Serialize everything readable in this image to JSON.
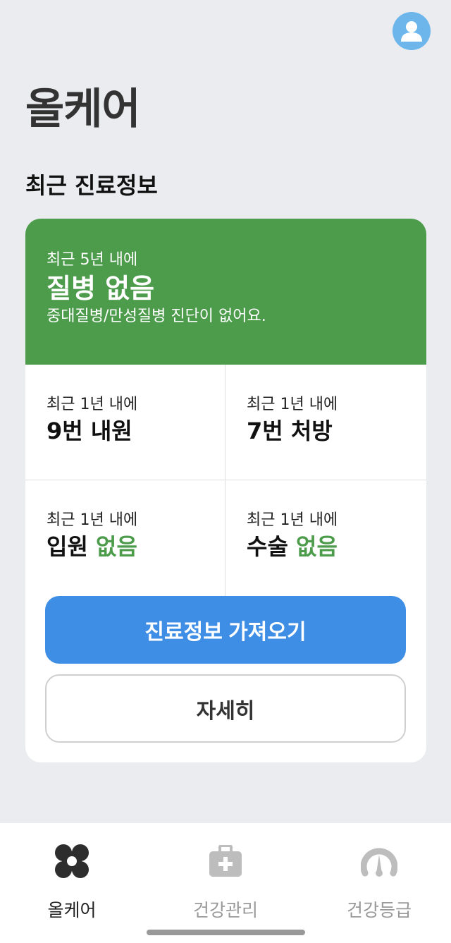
{
  "header": {
    "app_title": "올케어",
    "avatar_icon": "user-avatar-icon"
  },
  "section": {
    "title": "최근 진료정보"
  },
  "hero": {
    "subtitle": "최근 5년 내에",
    "main": "질병 없음",
    "description": "중대질병/만성질병 진단이 없어요.",
    "color": "#4c9c4c"
  },
  "stats": [
    {
      "subtitle": "최근 1년 내에",
      "label": "9번 내원",
      "accent": ""
    },
    {
      "subtitle": "최근 1년 내에",
      "label": "7번 처방",
      "accent": ""
    },
    {
      "subtitle": "최근 1년 내에",
      "label": "입원",
      "accent": "없음"
    },
    {
      "subtitle": "최근 1년 내에",
      "label": "수술",
      "accent": "없음"
    }
  ],
  "buttons": {
    "primary": "진료정보 가져오기",
    "secondary": "자세히",
    "primary_color": "#3f8ee6"
  },
  "tabbar": {
    "tabs": [
      {
        "label": "올케어",
        "icon": "allcare-logo-icon",
        "active": true
      },
      {
        "label": "건강관리",
        "icon": "medical-kit-icon",
        "active": false
      },
      {
        "label": "건강등급",
        "icon": "gauge-icon",
        "active": false
      }
    ]
  }
}
